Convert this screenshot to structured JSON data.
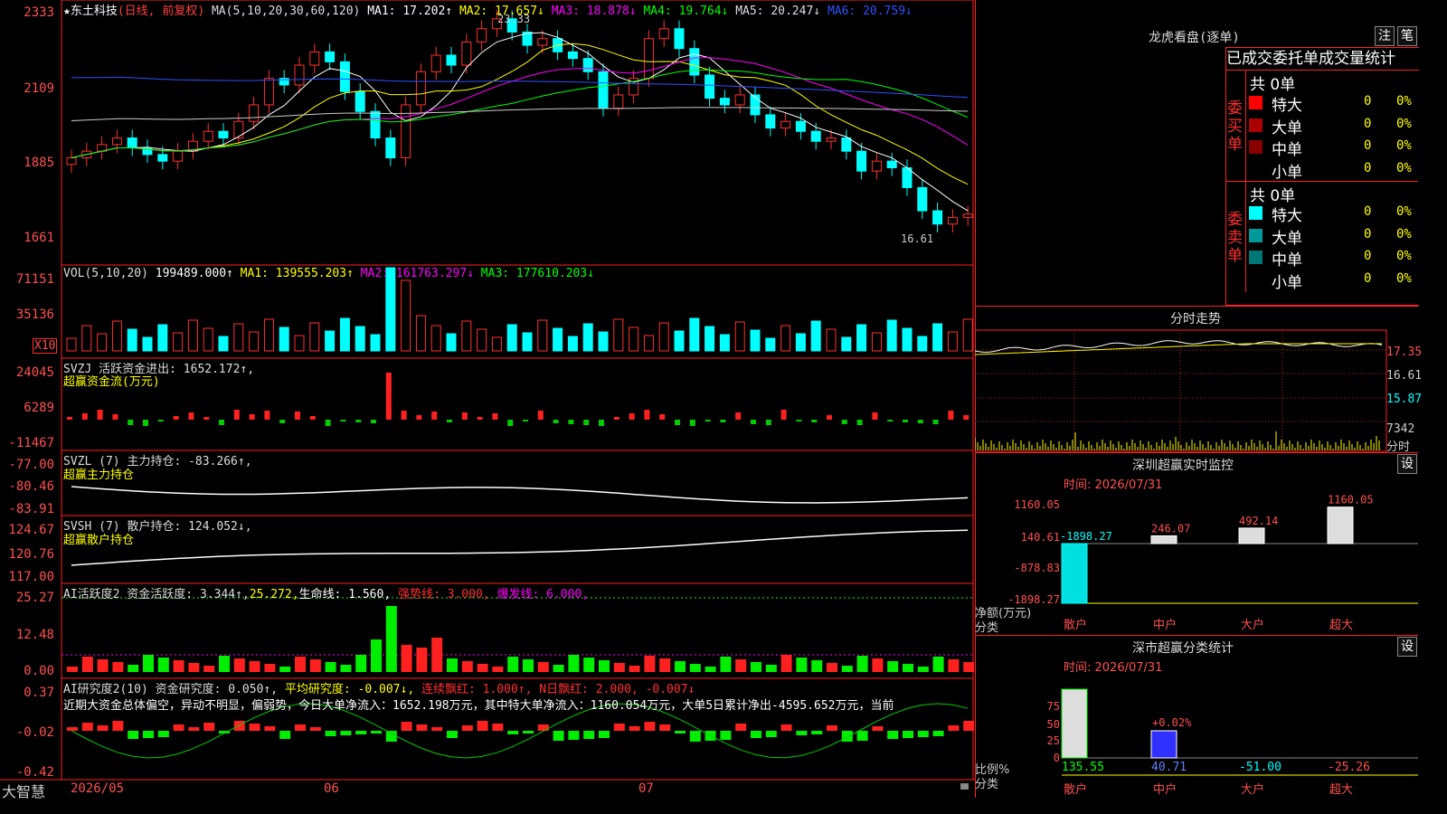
{
  "header": {
    "star": "★",
    "stock_name": "东土科技",
    "period": "(日线, 前复权)",
    "ma_title": "MA(5,10,20,30,60,120)",
    "ma1": "MA1: 17.202↑",
    "ma2": "MA2: 17.657↓",
    "ma3": "MA3: 18.878↓",
    "ma4": "MA4: 19.764↓",
    "ma5": "MA5: 20.247↓",
    "ma6": "MA6: 20.759↓"
  },
  "price": {
    "y_labels": [
      "2333",
      "2109",
      "1885",
      "1661"
    ],
    "high_mark": "23.33",
    "low_mark": "16.61"
  },
  "vol": {
    "title": "VOL(5,10,20)",
    "value": "199489.000↑",
    "ma1": "MA1: 139555.203↑",
    "ma2": "MA2: 161763.297↓",
    "ma3": "MA3: 177610.203↓",
    "y_labels": [
      "71151",
      "35136"
    ],
    "unit": "X10"
  },
  "svzj": {
    "title": "SVZJ  活跃资金进出: 1652.172↑,",
    "subtitle": "超赢资金流(万元)",
    "y_labels": [
      "24045",
      "6289",
      "-11467"
    ]
  },
  "svzl": {
    "title": "SVZL (7) 主力持仓: -83.266↑,",
    "subtitle": "超赢主力持仓",
    "y_labels": [
      "-77.00",
      "-80.46",
      "-83.91"
    ]
  },
  "svsh": {
    "title": "SVSH (7) 散户持仓: 124.052↓,",
    "subtitle": "超赢散户持仓",
    "y_labels": [
      "124.67",
      "120.76",
      "117.00"
    ]
  },
  "ai1": {
    "title": "AI活跃度2 资金活跃度: 3.344↑,",
    "v2": "25.272,",
    "v3": "生命线: 1.560,",
    "v4": "强势线: 3.000,",
    "v5": "爆发线: 6.000,",
    "y_labels": [
      "25.27",
      "12.48",
      "0.00"
    ]
  },
  "ai2": {
    "title": "AI研究度2(10) 资金研究度: 0.050↑,",
    "v2": "平均研究度: -0.007↓,",
    "v3": "连续飘红: 1.000↑,",
    "v4": "N日飘红: 2.000, -0.007↓",
    "text": "近期大资金总体偏空，异动不明显，偏弱势，今日大单净流入：1652.198万元，其中特大单净流入：1160.054万元，大单5日累计净出-4595.652万元，当前",
    "y_labels": [
      "0.37",
      "-0.02",
      "-0.42"
    ]
  },
  "bottom_bar": {
    "brand": "大智慧",
    "dates": [
      "2026/05",
      "06",
      "07"
    ]
  },
  "dragon": {
    "title": "龙虎看盘(逐单)",
    "btn1": "注",
    "btn2": "笔",
    "tab_header": "已成交委托单成交量统计",
    "buy_label": "委买单",
    "sell_label": "委卖单",
    "buy_total": "共 0单",
    "sell_total": "共 0单",
    "buy_rows": [
      {
        "label": "特大",
        "count": "0",
        "pct": "0%"
      },
      {
        "label": "大单",
        "count": "0",
        "pct": "0%"
      },
      {
        "label": "中单",
        "count": "0",
        "pct": "0%"
      },
      {
        "label": "小单",
        "count": "0",
        "pct": "0%"
      }
    ],
    "sell_rows": [
      {
        "label": "特大",
        "count": "0",
        "pct": "0%"
      },
      {
        "label": "大单",
        "count": "0",
        "pct": "0%"
      },
      {
        "label": "中单",
        "count": "0",
        "pct": "0%"
      },
      {
        "label": "小单",
        "count": "0",
        "pct": "0%"
      }
    ],
    "colors": {
      "buy": [
        "#ff0000",
        "#aa0000",
        "#880000",
        "#000000"
      ],
      "sell": [
        "#00ffff",
        "#009999",
        "#007777",
        "#000000"
      ]
    }
  },
  "intraday": {
    "title": "分时走势",
    "y_labels": [
      "17.35",
      "16.61",
      "15.87",
      "7342",
      "分时"
    ]
  },
  "sz_monitor": {
    "title": "深圳超赢实时监控",
    "btn": "设",
    "time": "时间: 2026/07/31",
    "y_labels": [
      "1160.05",
      "140.61",
      "-878.83",
      "-1898.27"
    ],
    "bar_labels": [
      "-1898.27",
      "246.07",
      "492.14",
      "1160.05"
    ],
    "side_label1": "净额(万元)",
    "side_label2": "分类",
    "categories": [
      "散户",
      "中户",
      "大户",
      "超大"
    ]
  },
  "sz_stats": {
    "title": "深市超赢分类统计",
    "btn": "设",
    "time": "时间: 2026/07/31",
    "y_labels": [
      "75",
      "50",
      "25",
      "0"
    ],
    "bar_label": "+0.02%",
    "side_label1": "比例%",
    "side_label2": "分类",
    "values": [
      "135.55",
      "40.71",
      "-51.00",
      "-25.26"
    ],
    "categories": [
      "散户",
      "中户",
      "大户",
      "超大"
    ]
  },
  "chart_data": [
    {
      "type": "candlestick",
      "title": "东土科技 (日线, 前复权)",
      "y_range": [
        16.61,
        23.33
      ],
      "x_labels": [
        "2026/05",
        "06",
        "07"
      ],
      "ohlc_close_approx": [
        19.0,
        19.2,
        19.4,
        19.6,
        19.3,
        19.1,
        18.9,
        19.2,
        19.5,
        19.8,
        19.6,
        20.1,
        20.6,
        21.4,
        21.2,
        21.8,
        22.2,
        21.9,
        21.0,
        20.4,
        19.6,
        19.0,
        20.6,
        21.6,
        22.1,
        21.8,
        22.5,
        22.9,
        23.2,
        22.8,
        22.4,
        22.6,
        22.2,
        22.0,
        21.6,
        20.5,
        20.9,
        21.4,
        22.6,
        22.9,
        22.3,
        21.5,
        20.8,
        20.6,
        20.9,
        20.3,
        19.9,
        20.1,
        19.8,
        19.5,
        19.6,
        19.2,
        18.6,
        18.9,
        18.7,
        18.1,
        17.4,
        17.0,
        17.2,
        17.3
      ]
    },
    {
      "type": "bar",
      "title": "VOL(5,10,20)",
      "y_range": [
        0,
        71151
      ]
    },
    {
      "type": "bar",
      "title": "深圳超赢实时监控",
      "categories": [
        "散户",
        "中户",
        "大户",
        "超大"
      ],
      "values": [
        -1898.27,
        246.07,
        492.14,
        1160.05
      ]
    },
    {
      "type": "bar",
      "title": "深市超赢分类统计",
      "categories": [
        "散户",
        "中户",
        "大户",
        "超大"
      ],
      "values": [
        135.55,
        40.71,
        -51.0,
        -25.26
      ]
    }
  ]
}
